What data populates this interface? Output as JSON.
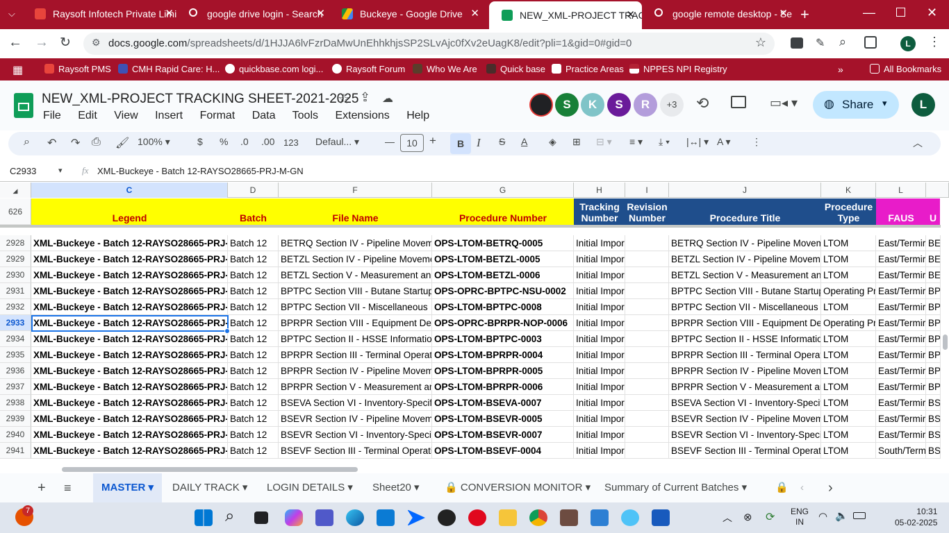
{
  "browser": {
    "tabs": [
      {
        "title": "Raysoft Infotech Private Limi",
        "color": "#d93025"
      },
      {
        "title": "google drive login - Search",
        "color": "#e8eaed"
      },
      {
        "title": "Buckeye - Google Drive",
        "color": "#1e8e3e"
      },
      {
        "title": "NEW_XML-PROJECT TRACKI",
        "color": "#0f9d58"
      },
      {
        "title": "google remote desktop - Se",
        "color": "#e8eaed"
      }
    ],
    "url_domain": "docs.google.com",
    "url_path": "/spreadsheets/d/1HJJA6lvFzrDaMwUnEhhkhjsSP2SLvAjc0fXv2eUagK8/edit?pli=1&gid=0#gid=0",
    "profile_initial": "L",
    "bookmarks": [
      "Raysoft PMS",
      "CMH Rapid Care: H...",
      "quickbase.com logi...",
      "Raysoft Forum",
      "Who We Are",
      "Quick base",
      "Practice Areas",
      "NPPES NPI Registry"
    ],
    "all_bookmarks": "All Bookmarks"
  },
  "sheets": {
    "doc_title": "NEW_XML-PROJECT TRACKING SHEET-2021-2025",
    "menu": [
      "File",
      "Edit",
      "View",
      "Insert",
      "Format",
      "Data",
      "Tools",
      "Extensions",
      "Help"
    ],
    "collaborators": [
      {
        "initial": "",
        "color": "#202124"
      },
      {
        "initial": "S",
        "color": "#188038"
      },
      {
        "initial": "K",
        "color": "#80c4c8"
      },
      {
        "initial": "S",
        "color": "#6a1b9a"
      },
      {
        "initial": "R",
        "color": "#b39ddb"
      }
    ],
    "collaborators_more": "+3",
    "share_label": "Share",
    "user_initial": "L",
    "toolbar": {
      "zoom": "100%",
      "currency": "$",
      "percent": "%",
      "dec_less": ".0",
      "dec_more": ".00",
      "number_format": "123",
      "font": "Defaul...",
      "font_size": "10"
    },
    "name_box": "C2933",
    "formula": "XML-Buckeye - Batch 12-RAYSO28665-PRJ-M-GN",
    "corner_row": "626",
    "columns": [
      "C",
      "D",
      "F",
      "G",
      "H",
      "I",
      "J",
      "K",
      "L"
    ],
    "header_row": [
      "Legend",
      "Batch",
      "File Name",
      "Procedure Number",
      "Tracking Number",
      "Revision Number",
      "Procedure Title",
      "Procedure Type",
      "FAUS",
      "U"
    ],
    "rows": [
      {
        "n": "2928",
        "c": "XML-Buckeye - Batch 12-RAYSO28665-PRJ-",
        "d": "Batch 12",
        "f": "BETRQ Section IV - Pipeline Moveme",
        "g": "OPS-LTOM-BETRQ-0005",
        "h": "Initial Impor",
        "i": "",
        "j": "BETRQ Section IV - Pipeline Moveme",
        "k": "LTOM",
        "l": "East/Termir",
        "m": "BET"
      },
      {
        "n": "2929",
        "c": "XML-Buckeye - Batch 12-RAYSO28665-PRJ-",
        "d": "Batch 12",
        "f": "BETZL Section IV - Pipeline Movemer",
        "g": "OPS-LTOM-BETZL-0005",
        "h": "Initial Impor",
        "i": "",
        "j": "BETZL Section IV - Pipeline Moveme",
        "k": "LTOM",
        "l": "East/Termir",
        "m": "BET"
      },
      {
        "n": "2930",
        "c": "XML-Buckeye - Batch 12-RAYSO28665-PRJ-",
        "d": "Batch 12",
        "f": "BETZL Section V - Measurement and",
        "g": "OPS-LTOM-BETZL-0006",
        "h": "Initial Impor",
        "i": "",
        "j": "BETZL Section V - Measurement and",
        "k": "LTOM",
        "l": "East/Termir",
        "m": "BET"
      },
      {
        "n": "2931",
        "c": "XML-Buckeye - Batch 12-RAYSO28665-PRJ-",
        "d": "Batch 12",
        "f": "BPTPC Section VIII - Butane Startup A",
        "g": "OPS-OPRC-BPTPC-NSU-0002",
        "h": "Initial Impor",
        "i": "",
        "j": "BPTPC Section VIII - Butane Startup A",
        "k": "Operating Pr",
        "l": "East/Termir",
        "m": "BPT"
      },
      {
        "n": "2932",
        "c": "XML-Buckeye - Batch 12-RAYSO28665-PRJ-",
        "d": "Batch 12",
        "f": "BPTPC Section VII - Miscellaneous",
        "g": "OPS-LTOM-BPTPC-0008",
        "h": "Initial Impor",
        "i": "",
        "j": "BPTPC Section VII - Miscellaneous",
        "k": "LTOM",
        "l": "East/Termir",
        "m": "BPT"
      },
      {
        "n": "2933",
        "c": "XML-Buckeye - Batch 12-RAYSO28665-PRJ-",
        "d": "Batch 12",
        "f": "BPRPR Section VIII - Equipment Defic",
        "g": "OPS-OPRC-BPRPR-NOP-0006",
        "h": "Initial Impor",
        "i": "",
        "j": "BPRPR Section VIII - Equipment Defic",
        "k": "Operating Pr",
        "l": "East/Termir",
        "m": "BPI"
      },
      {
        "n": "2934",
        "c": "XML-Buckeye - Batch 12-RAYSO28665-PRJ-",
        "d": "Batch 12",
        "f": "BPTPC Section II - HSSE Information",
        "g": "OPS-LTOM-BPTPC-0003",
        "h": "Initial Impor",
        "i": "",
        "j": "BPTPC Section II - HSSE Information",
        "k": "LTOM",
        "l": "East/Termir",
        "m": "BPT"
      },
      {
        "n": "2935",
        "c": "XML-Buckeye - Batch 12-RAYSO28665-PRJ-",
        "d": "Batch 12",
        "f": "BPRPR Section III - Terminal Operatic",
        "g": "OPS-LTOM-BPRPR-0004",
        "h": "Initial Impor",
        "i": "",
        "j": "BPRPR Section III - Terminal Operatic",
        "k": "LTOM",
        "l": "East/Termir",
        "m": "BPI"
      },
      {
        "n": "2936",
        "c": "XML-Buckeye - Batch 12-RAYSO28665-PRJ-",
        "d": "Batch 12",
        "f": "BPRPR Section IV - Pipeline Moveme",
        "g": "OPS-LTOM-BPRPR-0005",
        "h": "Initial Impor",
        "i": "",
        "j": "BPRPR Section IV - Pipeline Moveme",
        "k": "LTOM",
        "l": "East/Termir",
        "m": "BPI"
      },
      {
        "n": "2937",
        "c": "XML-Buckeye - Batch 12-RAYSO28665-PRJ-",
        "d": "Batch 12",
        "f": "BPRPR Section V - Measurement and",
        "g": "OPS-LTOM-BPRPR-0006",
        "h": "Initial Impor",
        "i": "",
        "j": "BPRPR Section V - Measurement anc",
        "k": "LTOM",
        "l": "East/Termir",
        "m": "BPI"
      },
      {
        "n": "2938",
        "c": "XML-Buckeye - Batch 12-RAYSO28665-PRJ-",
        "d": "Batch 12",
        "f": "BSEVA Section VI - Inventory-Specific",
        "g": "OPS-LTOM-BSEVA-0007",
        "h": "Initial Impor",
        "i": "",
        "j": "BSEVA Section VI - Inventory-Specifi",
        "k": "LTOM",
        "l": "East/Termir",
        "m": "BSI"
      },
      {
        "n": "2939",
        "c": "XML-Buckeye - Batch 12-RAYSO28665-PRJ-",
        "d": "Batch 12",
        "f": "BSEVR Section IV - Pipeline Moveme",
        "g": "OPS-LTOM-BSEVR-0005",
        "h": "Initial Impor",
        "i": "",
        "j": "BSEVR Section IV - Pipeline Moveme",
        "k": "LTOM",
        "l": "East/Termir",
        "m": "BSI"
      },
      {
        "n": "2940",
        "c": "XML-Buckeye - Batch 12-RAYSO28665-PRJ-",
        "d": "Batch 12",
        "f": "BSEVR Section VI - Inventory-Specific",
        "g": "OPS-LTOM-BSEVR-0007",
        "h": "Initial Impor",
        "i": "",
        "j": "BSEVR Section VI - Inventory-Specific",
        "k": "LTOM",
        "l": "East/Termir",
        "m": "BSI"
      },
      {
        "n": "2941",
        "c": "XML-Buckeye - Batch 12-RAYSO28665-PRJ-",
        "d": "Batch 12",
        "f": "BSEVF Section III - Terminal Operatio",
        "g": "OPS-LTOM-BSEVF-0004",
        "h": "Initial Impor",
        "i": "",
        "j": "BSEVF Section III - Terminal Operatio",
        "k": "LTOM",
        "l": "South/Term",
        "m": "BSI"
      }
    ],
    "sheet_tabs": [
      "MASTER",
      "DAILY TRACK",
      "LOGIN DETAILS",
      "Sheet20",
      "CONVERSION MONITOR",
      "Summary of Current Batches"
    ]
  },
  "taskbar": {
    "badge": "7",
    "lang_top": "ENG",
    "lang_bottom": "IN",
    "time": "10:31",
    "date": "05-02-2025"
  },
  "colors": {
    "chrome_red": "#a5122a",
    "header_yellow": "#ffff00",
    "header_blue": "#1f4e8c",
    "header_magenta": "#e81cc9",
    "selection_blue": "#1a73e8"
  }
}
